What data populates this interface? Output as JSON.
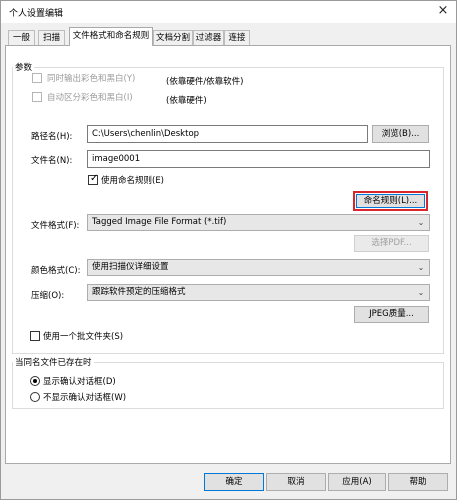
{
  "window": {
    "title": "个人设置编辑",
    "close_glyph": "×"
  },
  "tabs": [
    {
      "label": "一般"
    },
    {
      "label": "扫描"
    },
    {
      "label": "文件格式和命名规则"
    },
    {
      "label": "文档分割"
    },
    {
      "label": "过滤器"
    },
    {
      "label": "连接"
    }
  ],
  "params": {
    "group_label": "参数",
    "color_bw": {
      "label": "同时输出彩色和黑白(Y)",
      "note": "(依靠硬件/依靠软件)",
      "checked": false,
      "enabled": false
    },
    "auto_sep": {
      "label": "自动区分彩色和黑白(I)",
      "note": "(依靠硬件)",
      "checked": false,
      "enabled": false
    },
    "path": {
      "label": "路径名(H):",
      "value": "C:\\Users\\chenlin\\Desktop",
      "browse": "浏览(B)..."
    },
    "filename": {
      "label": "文件名(N):",
      "value": "image0001"
    },
    "use_naming": {
      "label": "使用命名规则(E)",
      "checked": true
    },
    "naming_rule_button": "命名规则(L)...",
    "format": {
      "label": "文件格式(F):",
      "value": "Tagged Image File Format (*.tif)"
    },
    "select_pdf_button": "选择PDF...",
    "color": {
      "label": "颜色格式(C):",
      "value": "使用扫描仪详细设置"
    },
    "compress": {
      "label": "压缩(O):",
      "value": "跟踪软件预定的压缩格式"
    },
    "jpeg_button": "JPEG质量...",
    "batch_folder": {
      "label": "使用一个批文件夹(S)",
      "checked": false
    },
    "highlight_color": "#d9262b"
  },
  "exists": {
    "group_label": "当同名文件已存在时",
    "options": [
      {
        "label": "显示确认对话框(D)",
        "selected": true
      },
      {
        "label": "不显示确认对话框(W)",
        "selected": false
      }
    ]
  },
  "footer": {
    "ok": "确定",
    "cancel": "取消",
    "apply": "应用(A)",
    "help": "帮助"
  },
  "icons": {
    "checkmark": "✓",
    "dropdown": "⌄"
  }
}
